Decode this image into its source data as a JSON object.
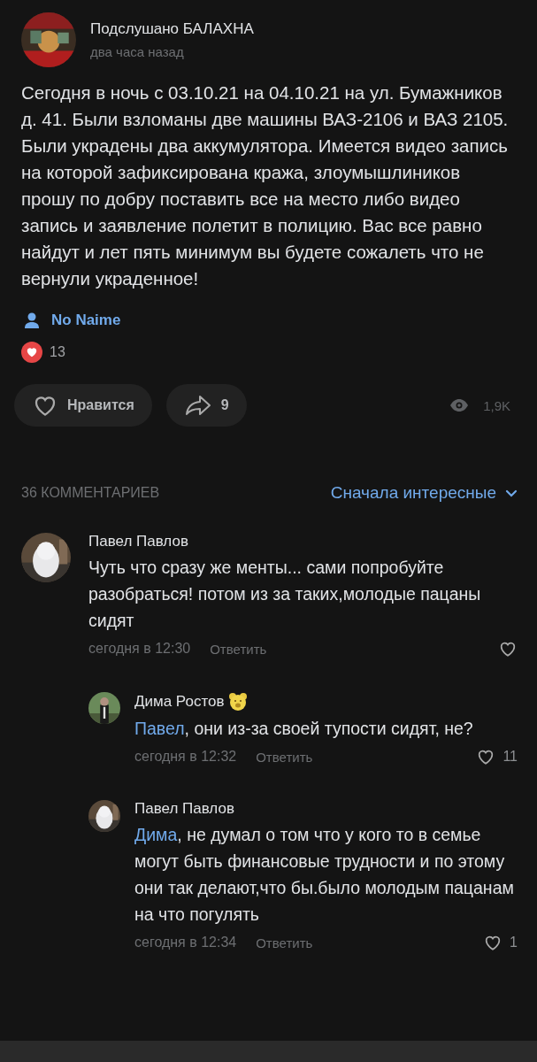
{
  "post": {
    "author": "Подслушано БАЛАХНА",
    "time": "два часа назад",
    "text": "Сегодня в ночь с 03.10.21 на 04.10.21 на ул. Бумажников д. 41. Были взломаны две машины ВАЗ-2106 и ВАЗ 2105. Были украдены два аккумулятора. Имеется видео запись на которой зафиксирована кража, злоумышлиников прошу по добру поставить все на место либо видео запись и заявление полетит в полицию. Вас все равно найдут и лет пять минимум вы будете сожалеть что не вернули украденное!",
    "signer": "No Naime",
    "reactions": "13",
    "like_label": "Нравится",
    "liked": false,
    "shares": "9",
    "views": "1,9K"
  },
  "comments_header": {
    "count": "36 КОММЕНТАРИЕВ",
    "sort": "Сначала интересные"
  },
  "comments": [
    {
      "author": "Павел Павлов",
      "badge": false,
      "text": "Чуть что сразу же менты... сами попробуйте разобраться! потом из за таких,молодые пацаны сидят",
      "time": "сегодня в 12:30",
      "reply": "Ответить",
      "children": [
        {
          "author": "Дима Ростов",
          "badge": true,
          "mention": "Павел",
          "text": ", они из-за своей тупости сидят, не?",
          "time": "сегодня в 12:32",
          "reply": "Ответить",
          "likes": "11"
        },
        {
          "author": "Павел Павлов",
          "badge": false,
          "mention": "Дима",
          "text": ", не думал о том что у кого то в семье могут быть финансовые трудности и по этому они так делают,что бы.было молодым пацанам на что погулять",
          "time": "сегодня в 12:34",
          "reply": "Ответить",
          "likes": "1"
        }
      ]
    }
  ]
}
